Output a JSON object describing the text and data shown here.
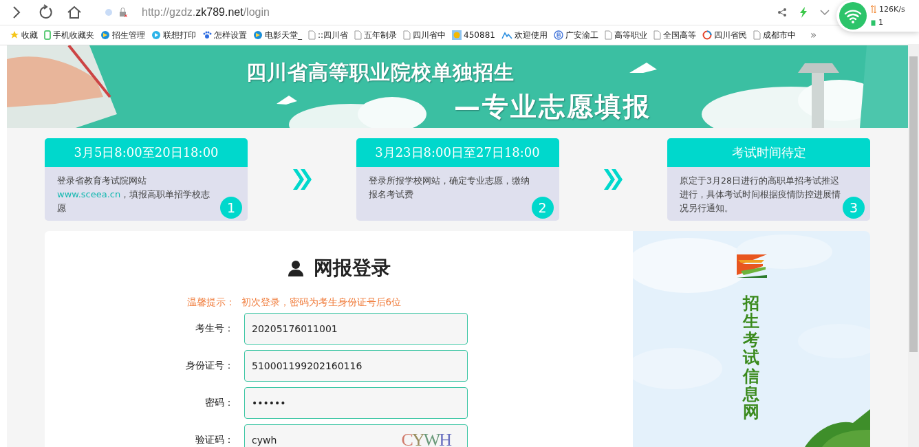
{
  "browser": {
    "url": {
      "prefix": "http://gzdz.",
      "domain": "zk789.net",
      "path": "/login"
    },
    "bookmarks": [
      {
        "label": "收藏",
        "kind": "star"
      },
      {
        "label": "手机收藏夹",
        "kind": "phone"
      },
      {
        "label": "招生管理",
        "kind": "app"
      },
      {
        "label": "联想打印",
        "kind": "play"
      },
      {
        "label": "怎样设置",
        "kind": "paw"
      },
      {
        "label": "电影天堂_",
        "kind": "app"
      },
      {
        "label": "::四川省",
        "kind": "page"
      },
      {
        "label": "五年制录",
        "kind": "page"
      },
      {
        "label": "四川省中",
        "kind": "page"
      },
      {
        "label": "450881",
        "kind": "sun"
      },
      {
        "label": "欢迎使用",
        "kind": "mountain"
      },
      {
        "label": "广安渝工",
        "kind": "letter"
      },
      {
        "label": "高等职业",
        "kind": "page"
      },
      {
        "label": "全国高等",
        "kind": "page"
      },
      {
        "label": "四川省民",
        "kind": "globe"
      },
      {
        "label": "成都市中",
        "kind": "page"
      }
    ],
    "more": "»",
    "network": {
      "speed": "126K/s",
      "count": "1"
    }
  },
  "banner": {
    "title": "四川省高等职业院校单独招生",
    "subtitle": "—专业志愿填报"
  },
  "steps": [
    {
      "header": "3月5日8:00至20日18:00",
      "number": "1",
      "body": [
        {
          "kind": "plain",
          "text": "登录省教育考试院网站"
        },
        {
          "kind": "link",
          "text": "www.sceea.cn"
        },
        {
          "kind": "plain",
          "text": "，填报高职单招学校志愿"
        }
      ]
    },
    {
      "header": "3月23日8:00日至27日18:00",
      "number": "2",
      "body": [
        {
          "kind": "plain",
          "text": "登录所报学校网站，确定专业志愿，缴纳报名考试费"
        }
      ]
    },
    {
      "header": "考试时间待定",
      "number": "3",
      "body": [
        {
          "kind": "plain",
          "text": "原定于3月28日进行的高职单招考试推迟进行，具体考试时间根据疫情防控进展情况另行通知。"
        }
      ]
    }
  ],
  "login": {
    "title": "网报登录",
    "hint_label": "温馨提示：",
    "hint": "初次登录，密码为考生身份证号后6位",
    "fields": [
      {
        "label": "考生号：",
        "value": "20205176011001",
        "kind": "text"
      },
      {
        "label": "身份证号：",
        "value": "510001199202160116",
        "kind": "text"
      },
      {
        "label": "密码：",
        "value": "••••••",
        "kind": "text"
      },
      {
        "label": "验证码：",
        "value": "cywh",
        "kind": "captcha",
        "captcha": "CYWH"
      }
    ]
  },
  "side": {
    "title": "招生考试信息网"
  }
}
